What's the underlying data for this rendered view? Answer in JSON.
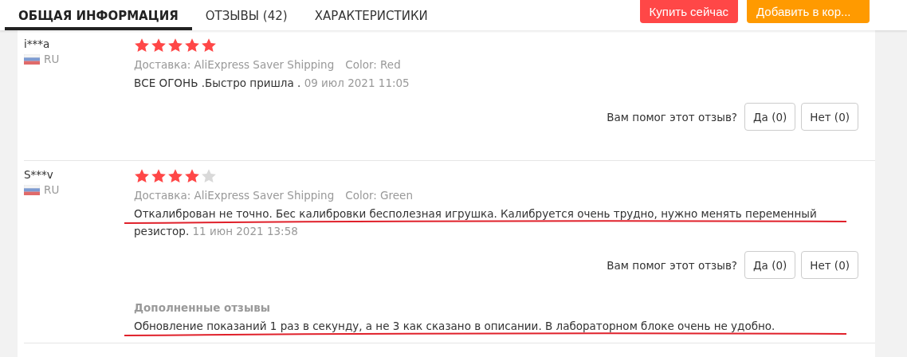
{
  "tabs": [
    {
      "label": "ОБЩАЯ ИНФОРМАЦИЯ",
      "selected": true
    },
    {
      "label": "ОТЗЫВЫ (42)",
      "selected": false
    },
    {
      "label": "ХАРАКТЕРИСТИКИ",
      "selected": false
    }
  ],
  "actions": [
    {
      "label": "Купить сейчас",
      "kind": "buy"
    },
    {
      "label": "Добавить в кор...",
      "kind": "cart"
    }
  ],
  "reviews": [
    {
      "user": "i***a",
      "country": "RU",
      "stars": 5,
      "delivery": "Доставка: AliExpress Saver Shipping",
      "variant": "Color: Red",
      "text": "ВСЕ ОГОНЬ .Быстро пришла .",
      "underlined": false,
      "date": "09 июл 2021 11:05",
      "helpful_prompt": "Вам помог этот отзыв?",
      "yes": "Да (0)",
      "no": "Нет (0)"
    },
    {
      "user": "S***v",
      "country": "RU",
      "stars": 4,
      "delivery": "Доставка: AliExpress Saver Shipping",
      "variant": "Color: Green",
      "text": "Откалиброван не точно. Бес калибровки бесполезная игрушка. Калибруется очень трудно, нужно менять переменный резистор.",
      "underlined": true,
      "date": "11 июн 2021 13:58",
      "helpful_prompt": "Вам помог этот отзыв?",
      "yes": "Да (0)",
      "no": "Нет (0)",
      "followup": {
        "title": "Дополненные отзывы",
        "text": "Обновление показаний 1 раз в секунду, а не 3 как сказано в описании. В лабораторном блоке очень не удобно.",
        "underlined": true
      }
    }
  ]
}
